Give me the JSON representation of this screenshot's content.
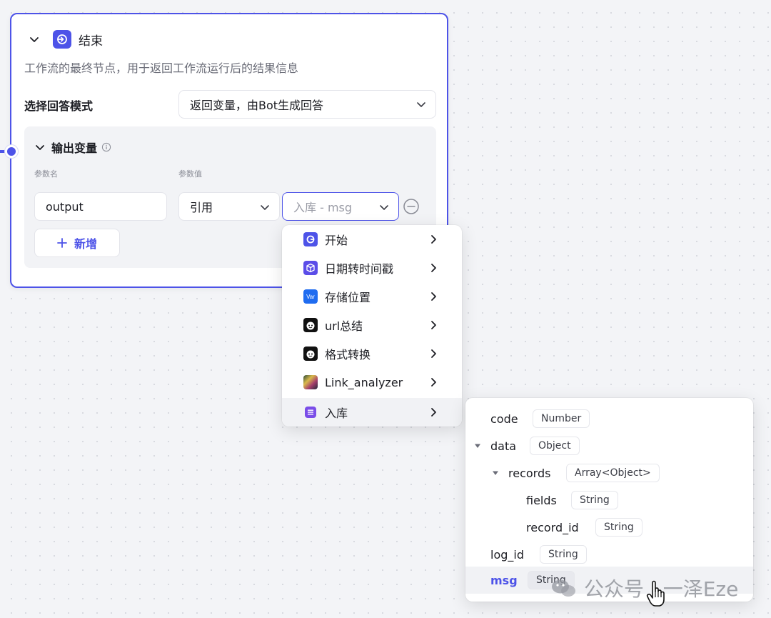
{
  "node": {
    "title": "结束",
    "description": "工作流的最终节点，用于返回工作流运行后的结果信息",
    "answer_mode_label": "选择回答模式",
    "answer_mode_value": "返回变量，由Bot生成回答",
    "outputs": {
      "title": "输出变量",
      "param_name_label": "参数名",
      "param_value_label": "参数值",
      "row": {
        "name": "output",
        "type": "引用",
        "reference": "入库 - msg"
      },
      "add_label": "新增"
    }
  },
  "menu": {
    "items": [
      {
        "label": "开始",
        "icon": "start-icon",
        "color": "#4d53e8"
      },
      {
        "label": "日期转时间戳",
        "icon": "cube-icon",
        "color": "#5b4de8"
      },
      {
        "label": "存储位置",
        "icon": "var-icon",
        "color": "#1f6cf0",
        "badge": "Var"
      },
      {
        "label": "url总结",
        "icon": "bot-avatar-icon",
        "color": "#111111"
      },
      {
        "label": "格式转换",
        "icon": "bot-avatar-icon",
        "color": "#111111"
      },
      {
        "label": "Link_analyzer",
        "icon": "image-avatar-icon",
        "color": "#1f2a38"
      },
      {
        "label": "入库",
        "icon": "database-icon",
        "color": "#7a4de8"
      }
    ],
    "active_index": 6
  },
  "tree": {
    "rows": [
      {
        "name": "code",
        "type": "Number",
        "level": 0,
        "expandable": false
      },
      {
        "name": "data",
        "type": "Object",
        "level": 0,
        "expandable": true
      },
      {
        "name": "records",
        "type": "Array<Object>",
        "level": 1,
        "expandable": true
      },
      {
        "name": "fields",
        "type": "String",
        "level": 2,
        "expandable": false
      },
      {
        "name": "record_id",
        "type": "String",
        "level": 2,
        "expandable": false
      },
      {
        "name": "log_id",
        "type": "String",
        "level": 0,
        "expandable": false
      },
      {
        "name": "msg",
        "type": "String",
        "level": 0,
        "expandable": false,
        "selected": true
      }
    ]
  },
  "watermark": {
    "text": "公众号 · 一泽Eze",
    "icon": "wechat-icon"
  },
  "colors": {
    "accent": "#4d53e8",
    "border": "#e3e4ea",
    "panel_bg": "#f2f3f6"
  }
}
